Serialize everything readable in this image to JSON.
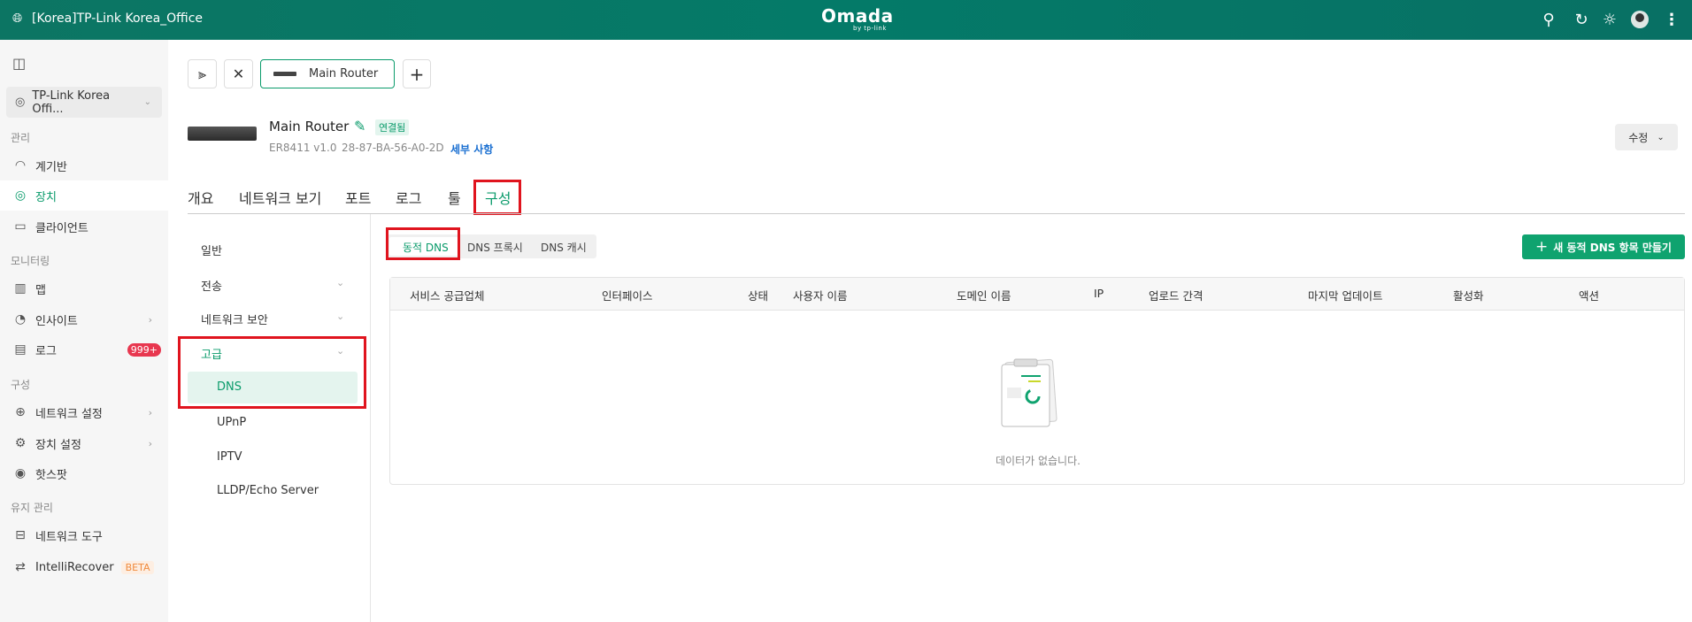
{
  "header": {
    "site": "[Korea]TP-Link Korea_Office",
    "logo": "Omada",
    "logo_sub": "by tp-link",
    "icons": [
      "search-icon",
      "refresh-icon",
      "theme-icon",
      "avatar",
      "more-icon"
    ]
  },
  "sidebar": {
    "site_selector": "TP-Link Korea Offi...",
    "sections": {
      "manage": "관리",
      "monitor": "모니터링",
      "config": "구성",
      "maintenance": "유지 관리"
    },
    "items": {
      "dashboard": "계기반",
      "devices": "장치",
      "clients": "클라이언트",
      "map": "맵",
      "insights": "인사이트",
      "logs": "로그",
      "logs_badge": "999+",
      "network_settings": "네트워크 설정",
      "device_settings": "장치 설정",
      "hotspot": "핫스팟",
      "network_tools": "네트워크 도구",
      "intellirecover": "IntelliRecover",
      "beta": "BETA"
    }
  },
  "toolbar": {
    "device_tab": "Main Router"
  },
  "device": {
    "name": "Main Router",
    "status": "연결됨",
    "model": "ER8411 v1.0",
    "mac": "28-87-BA-56-A0-2D",
    "details_link": "세부 사항",
    "edit_button": "수정"
  },
  "tabs": [
    "개요",
    "네트워크 보기",
    "포트",
    "로그",
    "툴",
    "구성"
  ],
  "subnav": {
    "general": "일반",
    "transmission": "전송",
    "network_security": "네트워크 보안",
    "advanced": "고급",
    "dns": "DNS",
    "upnp": "UPnP",
    "iptv": "IPTV",
    "lldp": "LLDP/Echo Server"
  },
  "dns_tabs": [
    "동적 DNS",
    "DNS 프록시",
    "DNS 캐시"
  ],
  "create_button": "새 동적 DNS 항목 만들기",
  "table": {
    "columns": [
      "서비스 공급업체",
      "인터페이스",
      "상태",
      "사용자 이름",
      "도메인 이름",
      "IP",
      "업로드 간격",
      "마지막 업데이트",
      "활성화",
      "액션"
    ],
    "rows": [],
    "empty_text": "데이터가 없습니다."
  },
  "colors": {
    "accent": "#0a9b6b",
    "header": "#047a68",
    "highlight": "#e0141e"
  }
}
